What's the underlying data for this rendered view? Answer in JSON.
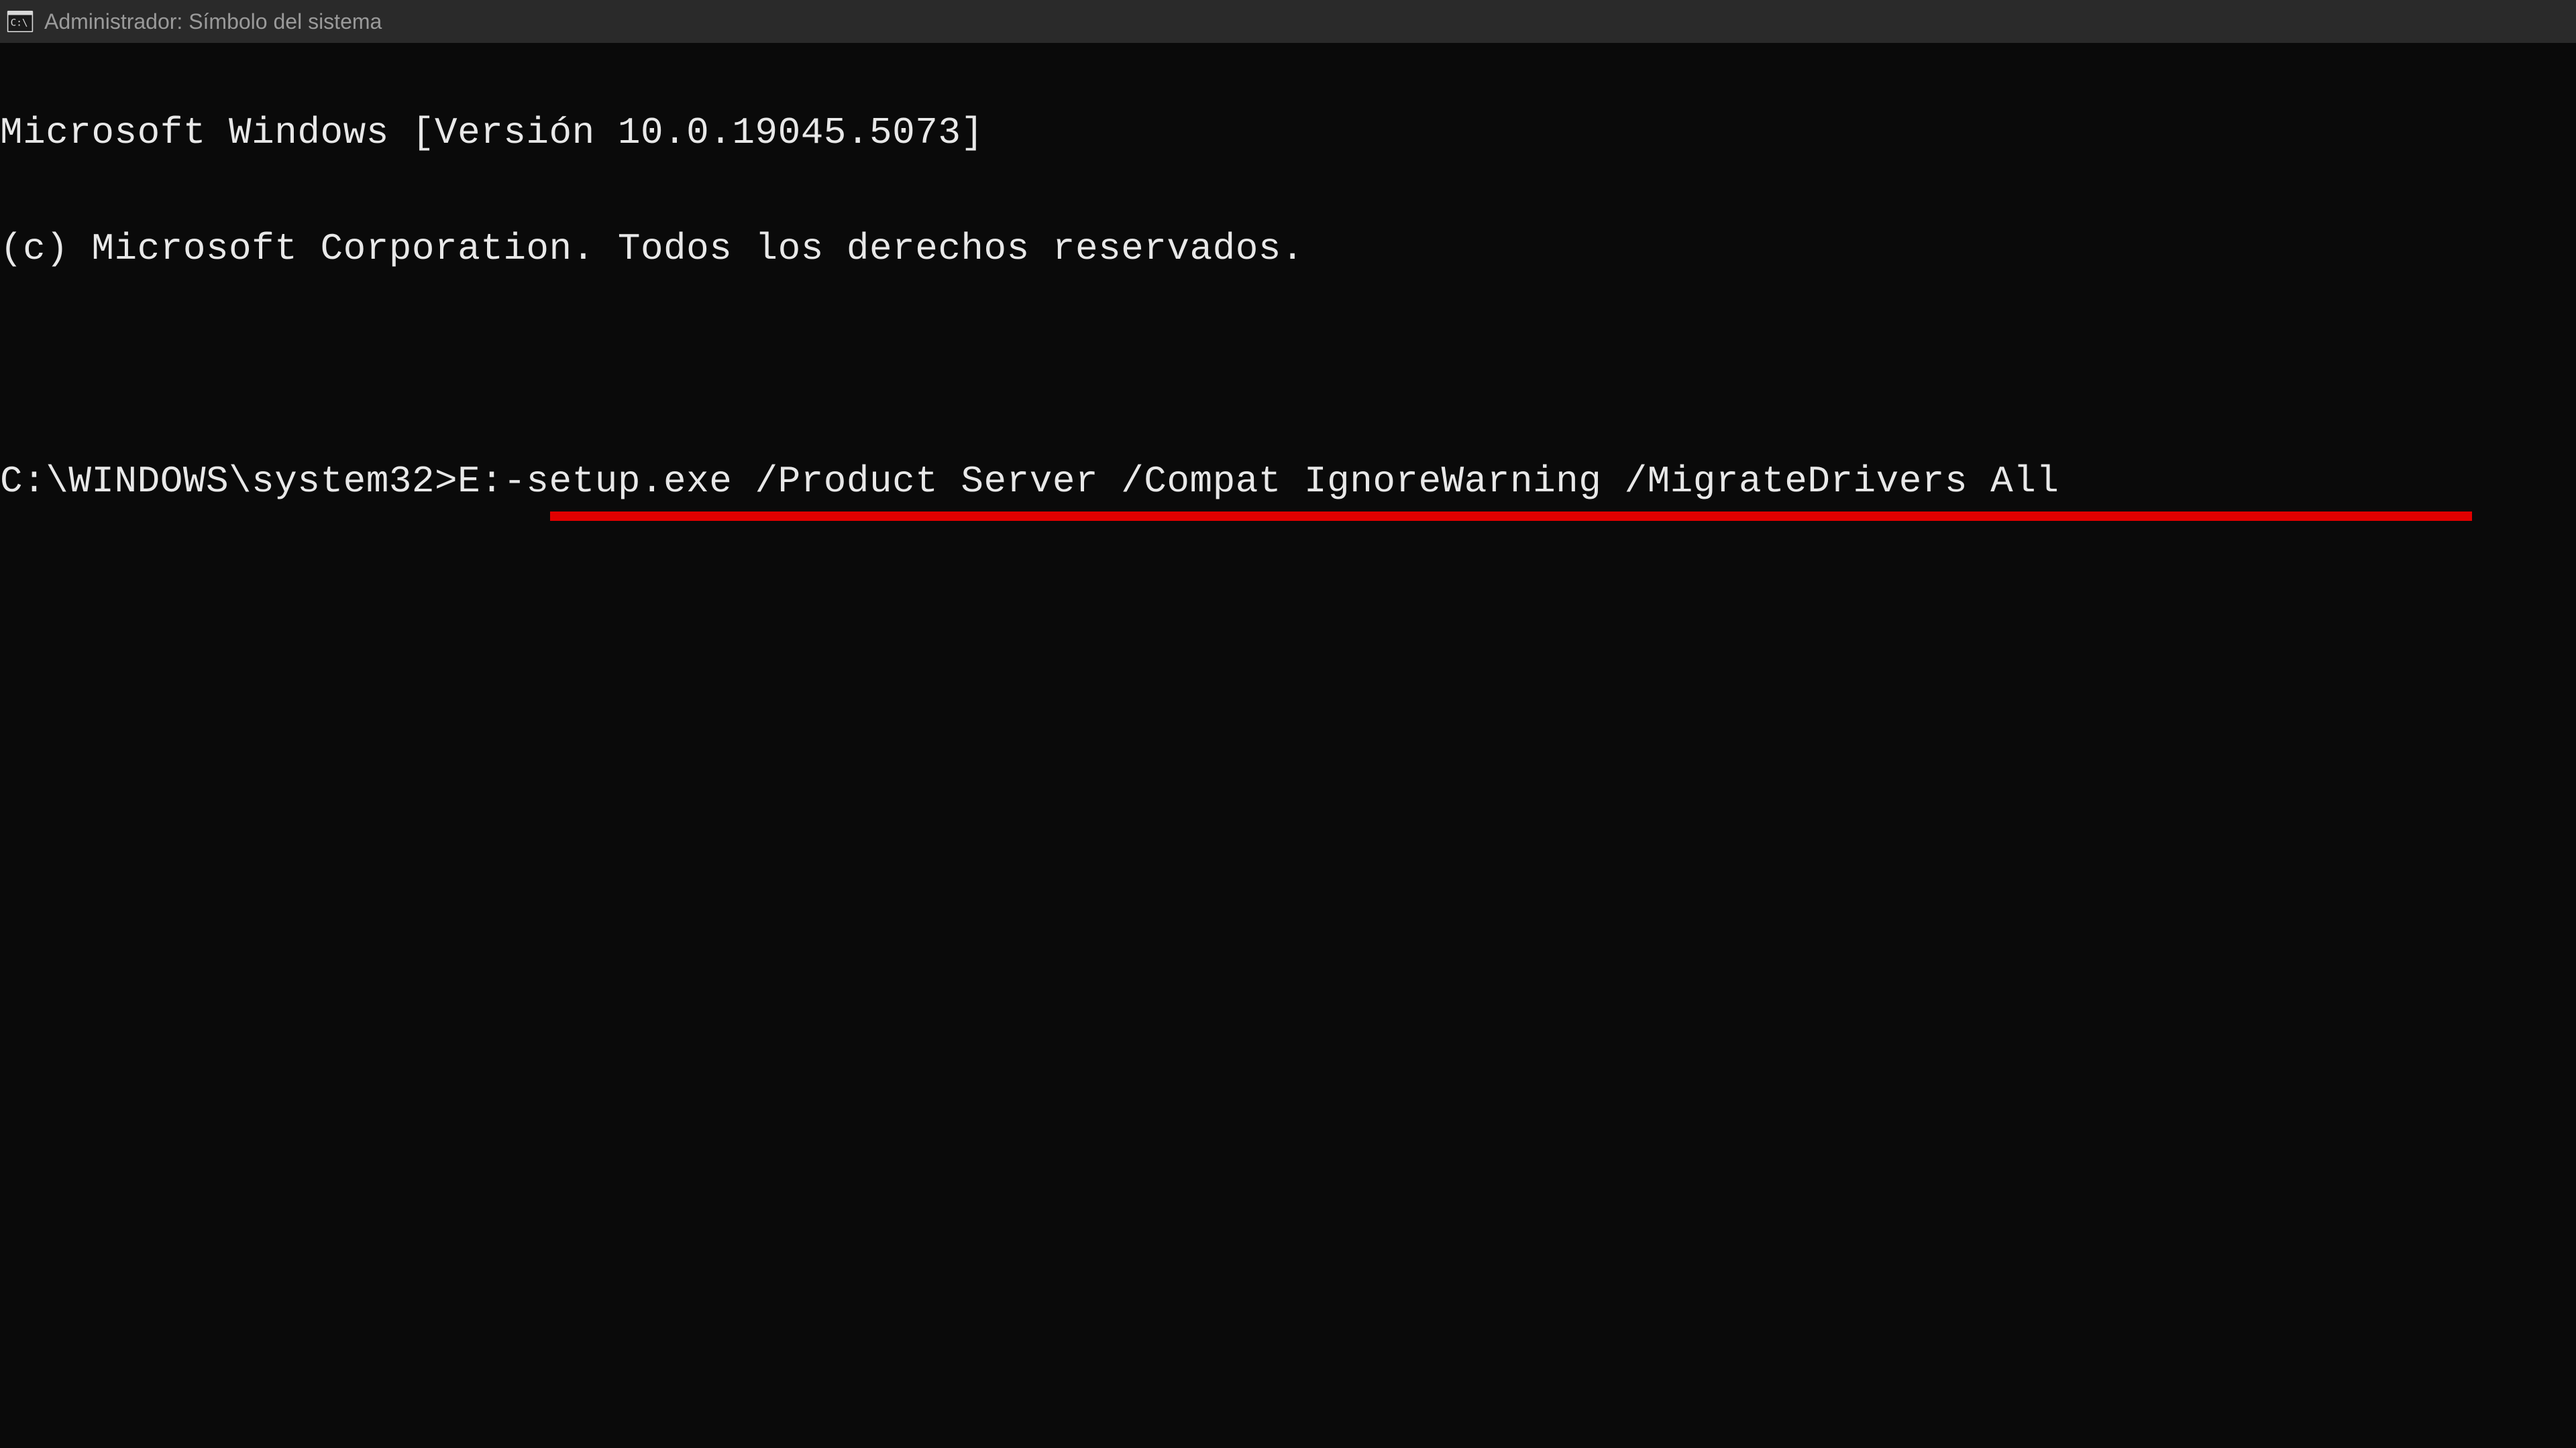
{
  "titlebar": {
    "title": "Administrador: Símbolo del sistema"
  },
  "terminal": {
    "line1": "Microsoft Windows [Versión 10.0.19045.5073]",
    "line2": "(c) Microsoft Corporation. Todos los derechos reservados.",
    "prompt": "C:\\WINDOWS\\system32>",
    "command": "E:-setup.exe /Product Server /Compat IgnoreWarning /MigrateDrivers All"
  }
}
